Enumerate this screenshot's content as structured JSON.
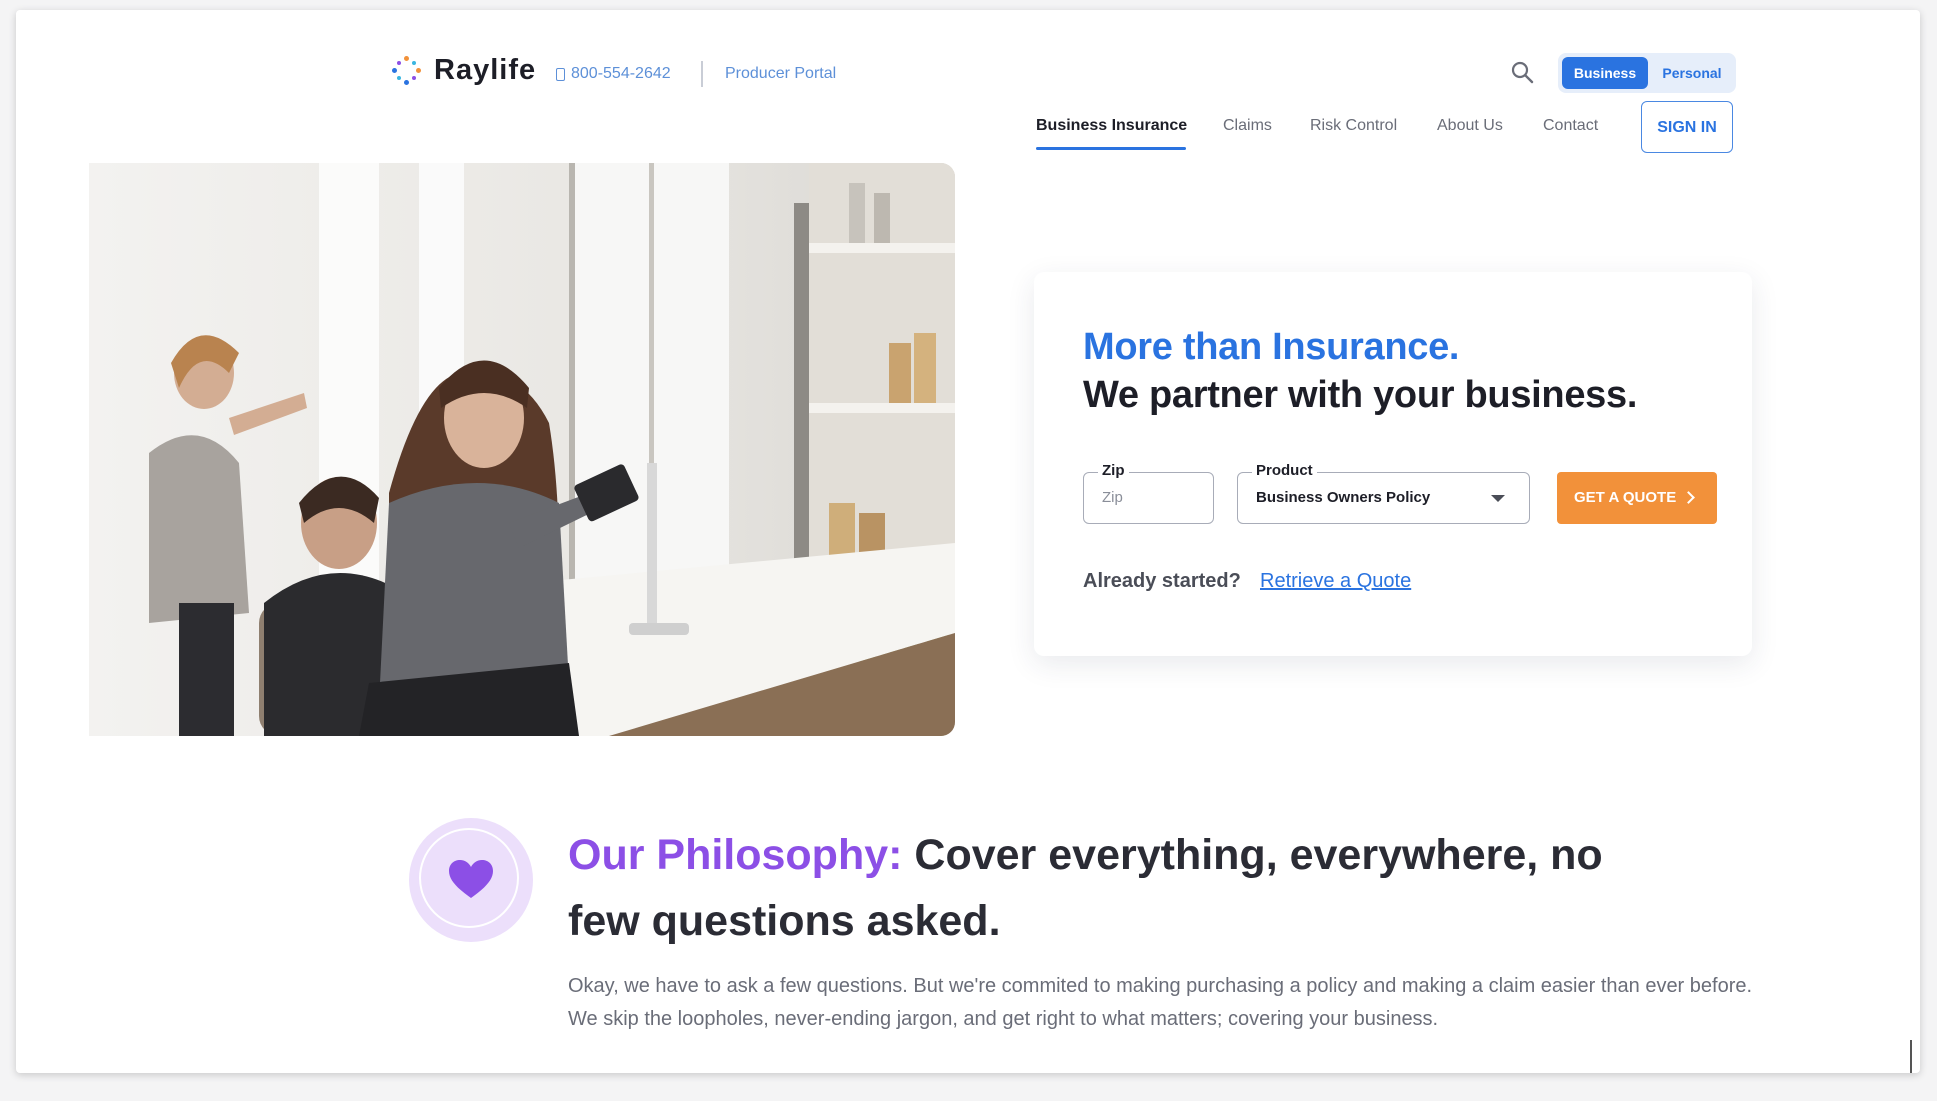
{
  "header": {
    "brand": "Raylife",
    "phone": "800-554-2642",
    "producer_portal": "Producer Portal",
    "segment": {
      "business": "Business",
      "personal": "Personal",
      "selected": "Business"
    },
    "nav": [
      "Business Insurance",
      "Claims",
      "Risk Control",
      "About Us",
      "Contact"
    ],
    "active_nav": "Business Insurance",
    "sign_in": "SIGN IN"
  },
  "quote": {
    "headline_blue": "More than Insurance.",
    "headline_dark": "We partner with your business.",
    "zip_label": "Zip",
    "zip_placeholder": "Zip",
    "product_label": "Product",
    "product_value": "Business Owners Policy",
    "cta": "GET A QUOTE",
    "already_started": "Already started?",
    "retrieve": "Retrieve a Quote"
  },
  "philosophy": {
    "accent": "Our Philosophy:",
    "title": "Cover everything, everywhere, no few questions asked.",
    "body": "Okay, we have to ask a few questions. But we're commited to making purchasing a policy and making a claim easier than ever before. We skip the loopholes, never-ending jargon, and get right to what matters; covering your business."
  },
  "colors": {
    "primary": "#2a73e0",
    "cta": "#f2913a",
    "accent_purple": "#8c4fe6",
    "heart_bg": "#ecdffb"
  },
  "icons": [
    "raylife-logo-icon",
    "phone-icon",
    "search-icon",
    "chevron-down-icon",
    "chevron-right-icon",
    "heart-icon"
  ]
}
